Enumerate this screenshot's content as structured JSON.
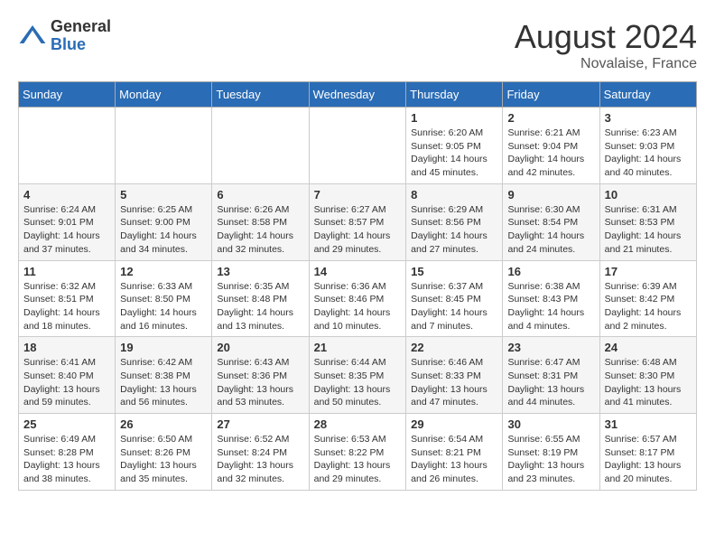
{
  "logo": {
    "general": "General",
    "blue": "Blue"
  },
  "title": "August 2024",
  "subtitle": "Novalaise, France",
  "days_header": [
    "Sunday",
    "Monday",
    "Tuesday",
    "Wednesday",
    "Thursday",
    "Friday",
    "Saturday"
  ],
  "weeks": [
    [
      {
        "num": "",
        "info": ""
      },
      {
        "num": "",
        "info": ""
      },
      {
        "num": "",
        "info": ""
      },
      {
        "num": "",
        "info": ""
      },
      {
        "num": "1",
        "info": "Sunrise: 6:20 AM\nSunset: 9:05 PM\nDaylight: 14 hours and 45 minutes."
      },
      {
        "num": "2",
        "info": "Sunrise: 6:21 AM\nSunset: 9:04 PM\nDaylight: 14 hours and 42 minutes."
      },
      {
        "num": "3",
        "info": "Sunrise: 6:23 AM\nSunset: 9:03 PM\nDaylight: 14 hours and 40 minutes."
      }
    ],
    [
      {
        "num": "4",
        "info": "Sunrise: 6:24 AM\nSunset: 9:01 PM\nDaylight: 14 hours and 37 minutes."
      },
      {
        "num": "5",
        "info": "Sunrise: 6:25 AM\nSunset: 9:00 PM\nDaylight: 14 hours and 34 minutes."
      },
      {
        "num": "6",
        "info": "Sunrise: 6:26 AM\nSunset: 8:58 PM\nDaylight: 14 hours and 32 minutes."
      },
      {
        "num": "7",
        "info": "Sunrise: 6:27 AM\nSunset: 8:57 PM\nDaylight: 14 hours and 29 minutes."
      },
      {
        "num": "8",
        "info": "Sunrise: 6:29 AM\nSunset: 8:56 PM\nDaylight: 14 hours and 27 minutes."
      },
      {
        "num": "9",
        "info": "Sunrise: 6:30 AM\nSunset: 8:54 PM\nDaylight: 14 hours and 24 minutes."
      },
      {
        "num": "10",
        "info": "Sunrise: 6:31 AM\nSunset: 8:53 PM\nDaylight: 14 hours and 21 minutes."
      }
    ],
    [
      {
        "num": "11",
        "info": "Sunrise: 6:32 AM\nSunset: 8:51 PM\nDaylight: 14 hours and 18 minutes."
      },
      {
        "num": "12",
        "info": "Sunrise: 6:33 AM\nSunset: 8:50 PM\nDaylight: 14 hours and 16 minutes."
      },
      {
        "num": "13",
        "info": "Sunrise: 6:35 AM\nSunset: 8:48 PM\nDaylight: 14 hours and 13 minutes."
      },
      {
        "num": "14",
        "info": "Sunrise: 6:36 AM\nSunset: 8:46 PM\nDaylight: 14 hours and 10 minutes."
      },
      {
        "num": "15",
        "info": "Sunrise: 6:37 AM\nSunset: 8:45 PM\nDaylight: 14 hours and 7 minutes."
      },
      {
        "num": "16",
        "info": "Sunrise: 6:38 AM\nSunset: 8:43 PM\nDaylight: 14 hours and 4 minutes."
      },
      {
        "num": "17",
        "info": "Sunrise: 6:39 AM\nSunset: 8:42 PM\nDaylight: 14 hours and 2 minutes."
      }
    ],
    [
      {
        "num": "18",
        "info": "Sunrise: 6:41 AM\nSunset: 8:40 PM\nDaylight: 13 hours and 59 minutes."
      },
      {
        "num": "19",
        "info": "Sunrise: 6:42 AM\nSunset: 8:38 PM\nDaylight: 13 hours and 56 minutes."
      },
      {
        "num": "20",
        "info": "Sunrise: 6:43 AM\nSunset: 8:36 PM\nDaylight: 13 hours and 53 minutes."
      },
      {
        "num": "21",
        "info": "Sunrise: 6:44 AM\nSunset: 8:35 PM\nDaylight: 13 hours and 50 minutes."
      },
      {
        "num": "22",
        "info": "Sunrise: 6:46 AM\nSunset: 8:33 PM\nDaylight: 13 hours and 47 minutes."
      },
      {
        "num": "23",
        "info": "Sunrise: 6:47 AM\nSunset: 8:31 PM\nDaylight: 13 hours and 44 minutes."
      },
      {
        "num": "24",
        "info": "Sunrise: 6:48 AM\nSunset: 8:30 PM\nDaylight: 13 hours and 41 minutes."
      }
    ],
    [
      {
        "num": "25",
        "info": "Sunrise: 6:49 AM\nSunset: 8:28 PM\nDaylight: 13 hours and 38 minutes."
      },
      {
        "num": "26",
        "info": "Sunrise: 6:50 AM\nSunset: 8:26 PM\nDaylight: 13 hours and 35 minutes."
      },
      {
        "num": "27",
        "info": "Sunrise: 6:52 AM\nSunset: 8:24 PM\nDaylight: 13 hours and 32 minutes."
      },
      {
        "num": "28",
        "info": "Sunrise: 6:53 AM\nSunset: 8:22 PM\nDaylight: 13 hours and 29 minutes."
      },
      {
        "num": "29",
        "info": "Sunrise: 6:54 AM\nSunset: 8:21 PM\nDaylight: 13 hours and 26 minutes."
      },
      {
        "num": "30",
        "info": "Sunrise: 6:55 AM\nSunset: 8:19 PM\nDaylight: 13 hours and 23 minutes."
      },
      {
        "num": "31",
        "info": "Sunrise: 6:57 AM\nSunset: 8:17 PM\nDaylight: 13 hours and 20 minutes."
      }
    ]
  ]
}
